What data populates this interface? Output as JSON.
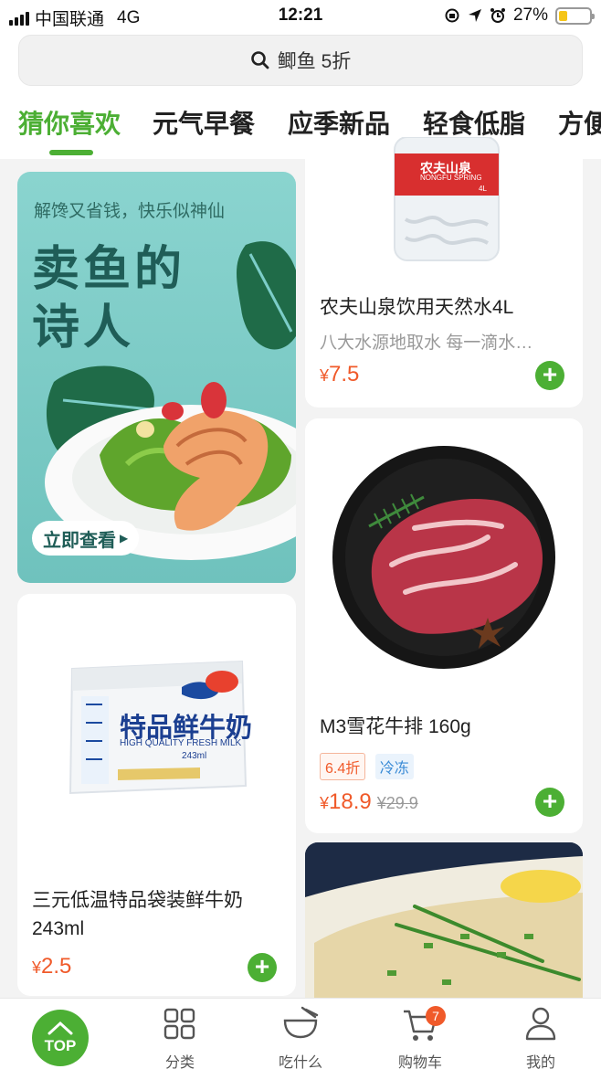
{
  "status_bar": {
    "carrier": "中国联通",
    "network": "4G",
    "time": "12:21",
    "battery": "27%"
  },
  "search": {
    "text": "鲫鱼 5折"
  },
  "tabs": [
    "猜你喜欢",
    "元气早餐",
    "应季新品",
    "轻食低脂",
    "方便"
  ],
  "banner": {
    "tagline": "解馋又省钱，快乐似神仙",
    "title_line1": "卖鱼的",
    "title_line2": "诗人",
    "button": "立即查看"
  },
  "products": {
    "water": {
      "name": "农夫山泉饮用天然水4L",
      "desc": "八大水源地取水 每一滴水都来自大自然",
      "yen": "¥",
      "price": "7.5",
      "pkg_brand": "农夫山泉",
      "pkg_en": "NONGFU SPRING",
      "pkg_size": "4L"
    },
    "beef": {
      "name": "M3雪花牛排 160g",
      "discount_tag": "6.4折",
      "cold_tag": "冷冻",
      "yen": "¥",
      "price": "18.9",
      "old_price": "¥29.9"
    },
    "milk": {
      "name": "三元低温特品袋装鲜牛奶243ml",
      "yen": "¥",
      "price": "2.5",
      "pkg_title": "特品鲜牛奶",
      "pkg_en": "HIGH QUALITY FRESH MILK",
      "pkg_size": "243ml"
    }
  },
  "nav": {
    "top": "TOP",
    "category": "分类",
    "eat": "吃什么",
    "cart": "购物车",
    "cart_count": "7",
    "mine": "我的"
  },
  "colors": {
    "accent": "#4caf34",
    "price": "#f05a2a",
    "banner_bg": "#7ccdc8"
  }
}
